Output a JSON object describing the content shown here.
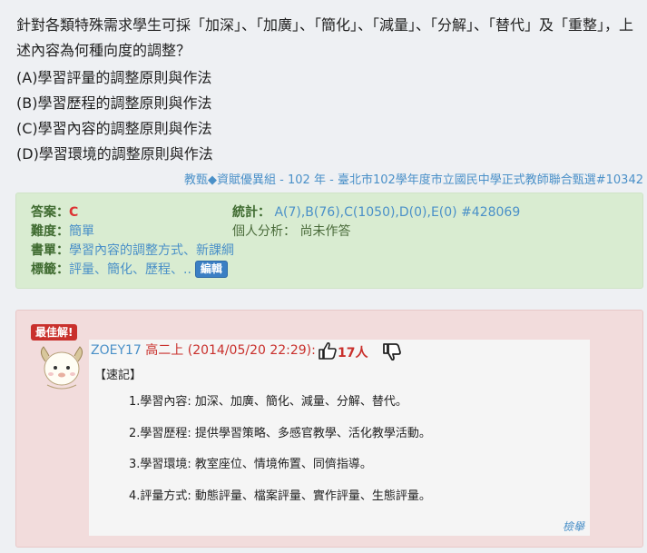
{
  "question": {
    "stem": "針對各類特殊需求學生可採「加深」、「加廣」、「簡化」、「減量」、「分解」、「替代」及「重整」，上述內容為何種向度的調整？",
    "options": [
      "(A)學習評量的調整原則與作法",
      "(B)學習歷程的調整原則與作法",
      "(C)學習內容的調整原則與作法",
      "(D)學習環境的調整原則與作法"
    ]
  },
  "source": {
    "category": "教甄◆資賦優異組",
    "sep1": " - ",
    "year": "102 年",
    "sep2": " - ",
    "exam": "臺北市102學年度市立國民中學正式教師聯合甄選#10342"
  },
  "info": {
    "answer_label": "答案：",
    "answer_value": "C",
    "stats_label": "統計：",
    "stats_value": "A(7),B(76),C(1050),D(0),E(0) #428069",
    "difficulty_label": "難度：",
    "difficulty_value": "簡單",
    "personal_label": "個人分析：",
    "personal_value": "尚未作答",
    "book_label": "書單：",
    "book_value": "學習內容的調整方式、新課綱",
    "tags_label": "標籤：",
    "tags_value": "評量、簡化、歷程、..",
    "edit_label": "編輯"
  },
  "best_answer": {
    "badge": "最佳解!",
    "user": "ZOEY17",
    "grade_time": "高二上 (2014/05/20 22:29):",
    "likes": "17人",
    "like_icon": "thumbs-up-icon",
    "dislike_icon": "thumbs-down-icon",
    "note_title": "【速記】",
    "notes": [
      "1.學習內容: 加深、加廣、簡化、減量、分解、替代。",
      "2.學習歷程: 提供學習策略、多感官教學、活化教學活動。",
      "3.學習環境: 教室座位、情境佈置、同儕指導。",
      "4.評量方式: 動態評量、檔案評量、實作評量、生態評量。"
    ],
    "translate_label": "檢舉"
  },
  "colors": {
    "link": "#4a90c8",
    "info_bg": "#d9ecd1",
    "best_bg": "#f2dcdc",
    "badge_bg": "#c9302c"
  }
}
